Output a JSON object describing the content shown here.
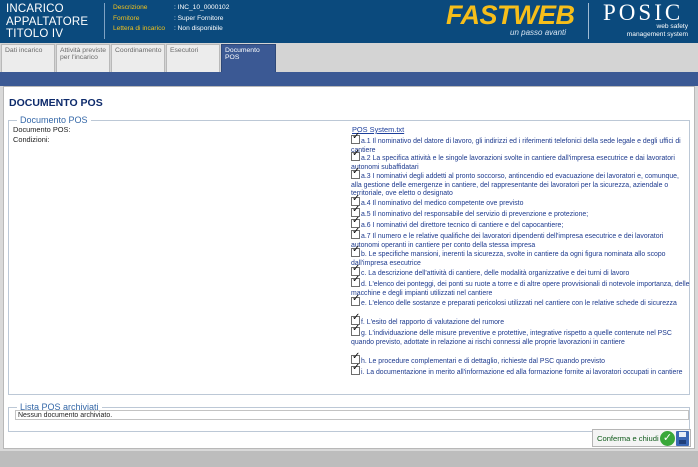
{
  "header": {
    "title_lines": [
      "INCARICO",
      "APPALTATORE",
      "TITOLO IV"
    ],
    "info": [
      {
        "key": "Descrizione",
        "value": ": INC_10_0000102"
      },
      {
        "key": "Fornitore",
        "value": ": Super Fornitore"
      },
      {
        "key": "Lettera di incarico",
        "value": ": Non disponibile"
      }
    ],
    "brand": {
      "fast": "FASTWEB",
      "tagline": "un passo avanti",
      "posic": "POSIC",
      "posic_sub1": "web safety",
      "posic_sub2": "management system"
    }
  },
  "tabs": [
    {
      "label": "Dati incarico",
      "active": false
    },
    {
      "label": "Attività previste per l'incarico",
      "active": false
    },
    {
      "label": "Coordinamento",
      "active": false
    },
    {
      "label": "Esecutori",
      "active": false
    },
    {
      "label": "Documento POS",
      "active": true
    }
  ],
  "page": {
    "title": "DOCUMENTO POS",
    "fieldset_legend": "Documento POS",
    "doc_label": "Documento POS:",
    "doc_file": "POS System.txt",
    "conditions_label": "Condizioni:",
    "conditions": [
      {
        "text": "a.1 Il nominativo del datore di lavoro, gli indirizzi ed i riferimenti telefonici della sede legale e degli uffici di cantiere",
        "checked": true
      },
      {
        "text": "a.2 La specifica attività e le singole lavorazioni svolte in cantiere dall'impresa esecutrice e dai lavoratori autonomi subaffidatari",
        "checked": true
      },
      {
        "text": "a.3 I nominativi degli addetti al pronto soccorso, antincendio ed evacuazione dei lavoratori e, comunque, alla gestione delle emergenze in cantiere, del rappresentante dei lavoratori per la sicurezza, aziendale o territoriale, ove eletto o designato",
        "checked": true
      },
      {
        "text": "a.4 Il nominativo del medico competente ove previsto",
        "checked": true
      },
      {
        "text": "a.5 Il nominativo del responsabile del servizio di prevenzione e protezione;",
        "checked": true
      },
      {
        "text": "a.6 I nominativi del direttore tecnico di cantiere e del capocantiere;",
        "checked": true
      },
      {
        "text": "a.7 Il numero e le relative qualifiche dei lavoratori dipendenti dell'impresa esecutrice e dei lavoratori autonomi operanti in cantiere per conto della stessa impresa",
        "checked": true
      },
      {
        "text": "b. Le specifiche mansioni, inerenti la sicurezza, svolte in cantiere da ogni figura nominata allo scopo dall'impresa esecutrice",
        "checked": true
      },
      {
        "text": "c. La descrizione dell'attività di cantiere, delle modalità organizzative e dei turni di lavoro",
        "checked": true
      },
      {
        "text": "d. L'elenco dei ponteggi, dei ponti su ruote a torre e di altre opere provvisionali di notevole importanza, delle macchine e degli impianti utilizzati nel cantiere",
        "checked": true
      },
      {
        "text": "e. L'elenco delle sostanze e preparati pericolosi utilizzati nel cantiere con le relative schede di sicurezza",
        "checked": true
      },
      {
        "text": "f. L'esito del rapporto di valutazione del rumore",
        "checked": true
      },
      {
        "text": "g. L'individuazione delle misure preventive e protettive, integrative rispetto a quelle contenute nel PSC quando previsto, adottate in relazione ai rischi connessi alle proprie lavorazioni in cantiere",
        "checked": true
      },
      {
        "text": "h. Le procedure complementari e di dettaglio, richieste dal PSC quando previsto",
        "checked": true
      },
      {
        "text": "i. La documentazione in merito all'informazione ed alla formazione fornite ai lavoratori occupati in cantiere",
        "checked": true
      }
    ],
    "archive_legend": "Lista POS archiviati",
    "archive_text": "Nessun documento archiviato."
  },
  "actions": {
    "confirm_label": "Conferma e chiudi"
  },
  "colors": {
    "header_bg": "#0b4a7d",
    "accent": "#3b5994",
    "brand_yellow": "#f6be1a"
  }
}
